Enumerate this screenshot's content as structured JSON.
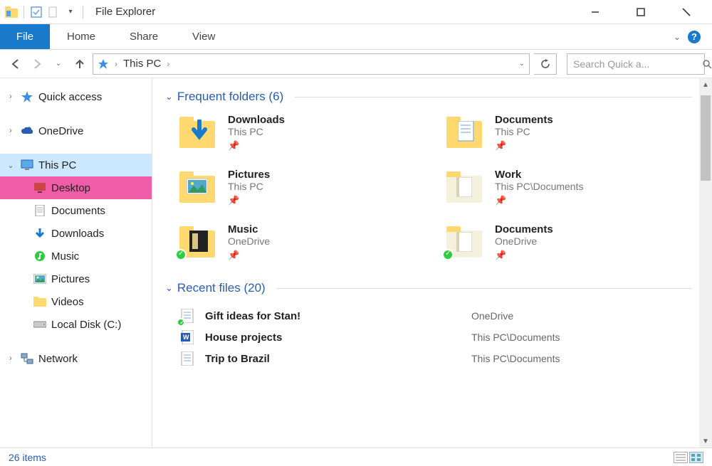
{
  "window": {
    "title": "File Explorer"
  },
  "ribbon": {
    "file": "File",
    "tabs": [
      "Home",
      "Share",
      "View"
    ]
  },
  "address": {
    "crumbs": [
      "This PC"
    ],
    "search_placeholder": "Search Quick a..."
  },
  "navpane": {
    "quick_access": "Quick access",
    "onedrive": "OneDrive",
    "this_pc": "This PC",
    "children": [
      "Desktop",
      "Documents",
      "Downloads",
      "Music",
      "Pictures",
      "Videos",
      "Local Disk (C:)"
    ],
    "network": "Network"
  },
  "content": {
    "frequent": {
      "label": "Frequent folders",
      "count": 6,
      "items": [
        {
          "name": "Downloads",
          "sub": "This PC"
        },
        {
          "name": "Documents",
          "sub": "This PC"
        },
        {
          "name": "Pictures",
          "sub": "This PC"
        },
        {
          "name": "Work",
          "sub": "This PC\\Documents"
        },
        {
          "name": "Music",
          "sub": "OneDrive"
        },
        {
          "name": "Documents",
          "sub": "OneDrive"
        }
      ]
    },
    "recent": {
      "label": "Recent files",
      "count": 20,
      "items": [
        {
          "name": "Gift ideas for Stan!",
          "loc": "OneDrive"
        },
        {
          "name": "House projects",
          "loc": "This PC\\Documents"
        },
        {
          "name": "Trip to Brazil",
          "loc": "This PC\\Documents"
        }
      ]
    }
  },
  "statusbar": {
    "items_label": "26 items"
  }
}
